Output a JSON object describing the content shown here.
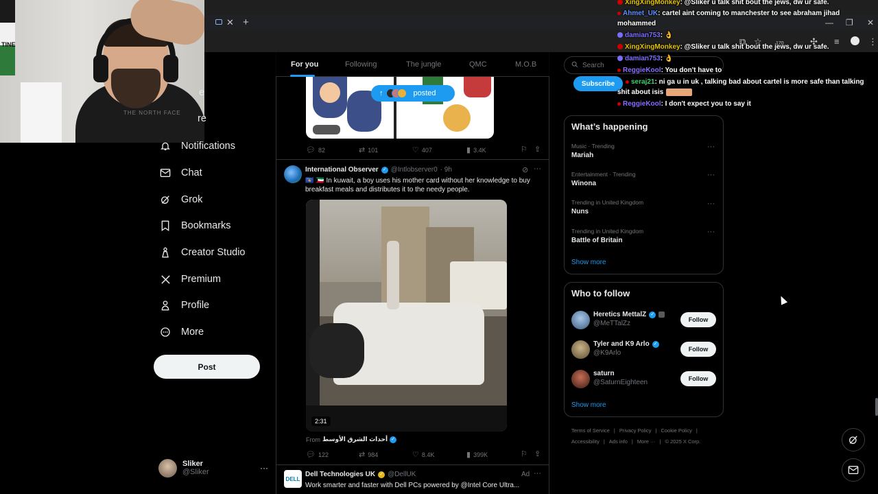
{
  "browser": {
    "tab_close": "✕",
    "new_tab": "+",
    "window_controls": [
      "—",
      "❐",
      "✕"
    ],
    "toolbar_icons": [
      "cast-icon",
      "star-icon",
      "extension-icon",
      "extension-icon",
      "puzzle-icon",
      "media-icon",
      "profile-icon",
      "menu-icon"
    ],
    "extension_badge": "170"
  },
  "webcam": {
    "poster_text": "TINE",
    "shirt_text": "THE NORTH FACE"
  },
  "nav": {
    "partial_1": "e",
    "partial_2": "re",
    "items": [
      {
        "label": "Notifications",
        "icon": "bell-icon"
      },
      {
        "label": "Chat",
        "icon": "mail-icon"
      },
      {
        "label": "Grok",
        "icon": "grok-icon"
      },
      {
        "label": "Bookmarks",
        "icon": "bookmark-icon"
      },
      {
        "label": "Creator Studio",
        "icon": "creator-studio-icon"
      },
      {
        "label": "Premium",
        "icon": "x-logo-icon"
      },
      {
        "label": "Profile",
        "icon": "person-icon"
      },
      {
        "label": "More",
        "icon": "more-circle-icon"
      }
    ],
    "post_label": "Post",
    "account": {
      "name": "Sliker",
      "handle": "@Sliker",
      "more": "···"
    }
  },
  "timeline": {
    "tabs": [
      "For you",
      "Following",
      "The jungle",
      "QMC",
      "M.O.B"
    ],
    "active_tab": "For you",
    "posted_pill": "posted",
    "tweet0_metrics": {
      "replies": "82",
      "reposts": "101",
      "likes": "407",
      "views": "3.4K"
    },
    "tweet1": {
      "name": "International Observer",
      "handle": "@Intlobserver0",
      "time": "· 9h",
      "text_line1": "🇽🇰 🇰🇼 In kuwait, a boy uses his mother card without her knowledge to buy",
      "text_line2": "breakfast meals and distributes it to the needy people.",
      "duration": "2:31",
      "from_label": "From",
      "from_source": "أحداث الشرق الأوسط",
      "metrics": {
        "replies": "122",
        "reposts": "984",
        "likes": "8.4K",
        "views": "399K"
      }
    },
    "tweet2": {
      "name": "Dell Technologies UK",
      "handle": "@DellUK",
      "ad_label": "Ad",
      "text": "Work smarter and faster with Dell PCs powered by @Intel Core Ultra..."
    }
  },
  "sidebar": {
    "search_placeholder": "Search",
    "subscribe_label": "Subscribe",
    "whats_happening": {
      "title": "What’s happening",
      "trends": [
        {
          "meta": "Music · Trending",
          "name": "Mariah"
        },
        {
          "meta": "Entertainment · Trending",
          "name": "Winona"
        },
        {
          "meta": "Trending in United Kingdom",
          "name": "Nuns"
        },
        {
          "meta": "Trending in United Kingdom",
          "name": "Battle of Britain"
        }
      ],
      "show_more": "Show more"
    },
    "who_to_follow": {
      "title": "Who to follow",
      "accounts": [
        {
          "name": "Heretics MettalZ",
          "handle": "@MeTTalZz",
          "button": "Follow"
        },
        {
          "name": "Tyler and K9 Arlo",
          "handle": "@K9Arlo",
          "button": "Follow"
        },
        {
          "name": "saturn",
          "handle": "@SaturnEighteen",
          "button": "Follow"
        }
      ],
      "show_more": "Show more"
    },
    "footer": {
      "row1": [
        "Terms of Service",
        "|",
        "Privacy Policy",
        "|",
        "Cookie Policy",
        "|"
      ],
      "row2": [
        "Accessibility",
        "|",
        "Ads info",
        "|",
        "More ···",
        "|",
        "© 2025 X Corp."
      ]
    }
  },
  "chat": [
    {
      "user": "XingXingMonkey",
      "color": "#e5c400",
      "msg": ": @Sliker u talk shit bout the jews, dw ur safe."
    },
    {
      "user": "Ahmet_UK",
      "color": "#5b8fff",
      "msg": ": cartel aint coming to manchester to see abraham jihad"
    },
    {
      "user": "",
      "color": "#ffffff",
      "msg": "mohammed"
    },
    {
      "user": "damian753",
      "color": "#7b6cff",
      "msg": ": 👌"
    },
    {
      "user": "XingXingMonkey",
      "color": "#e5c400",
      "msg": ": @Sliker u talk shit bout the jews, dw ur safe."
    },
    {
      "user": "damian753",
      "color": "#7b6cff",
      "msg": ": 👌"
    },
    {
      "user": "ReggieKool",
      "color": "#8a6cff",
      "msg": ": You don't have to"
    },
    {
      "user": "seraj21",
      "color": "#3ecf6a",
      "msg": ": ni ga u in uk , talking bad about cartel is more safe than talking"
    },
    {
      "user": "",
      "color": "#ffffff",
      "msg": "shit about isis"
    },
    {
      "user": "ReggieKool",
      "color": "#8a6cff",
      "msg": ": I don't expect you to say it"
    }
  ],
  "colors": {
    "accent": "#1d9bf0",
    "background": "#000000",
    "border": "#2f3336",
    "muted": "#71767b"
  }
}
